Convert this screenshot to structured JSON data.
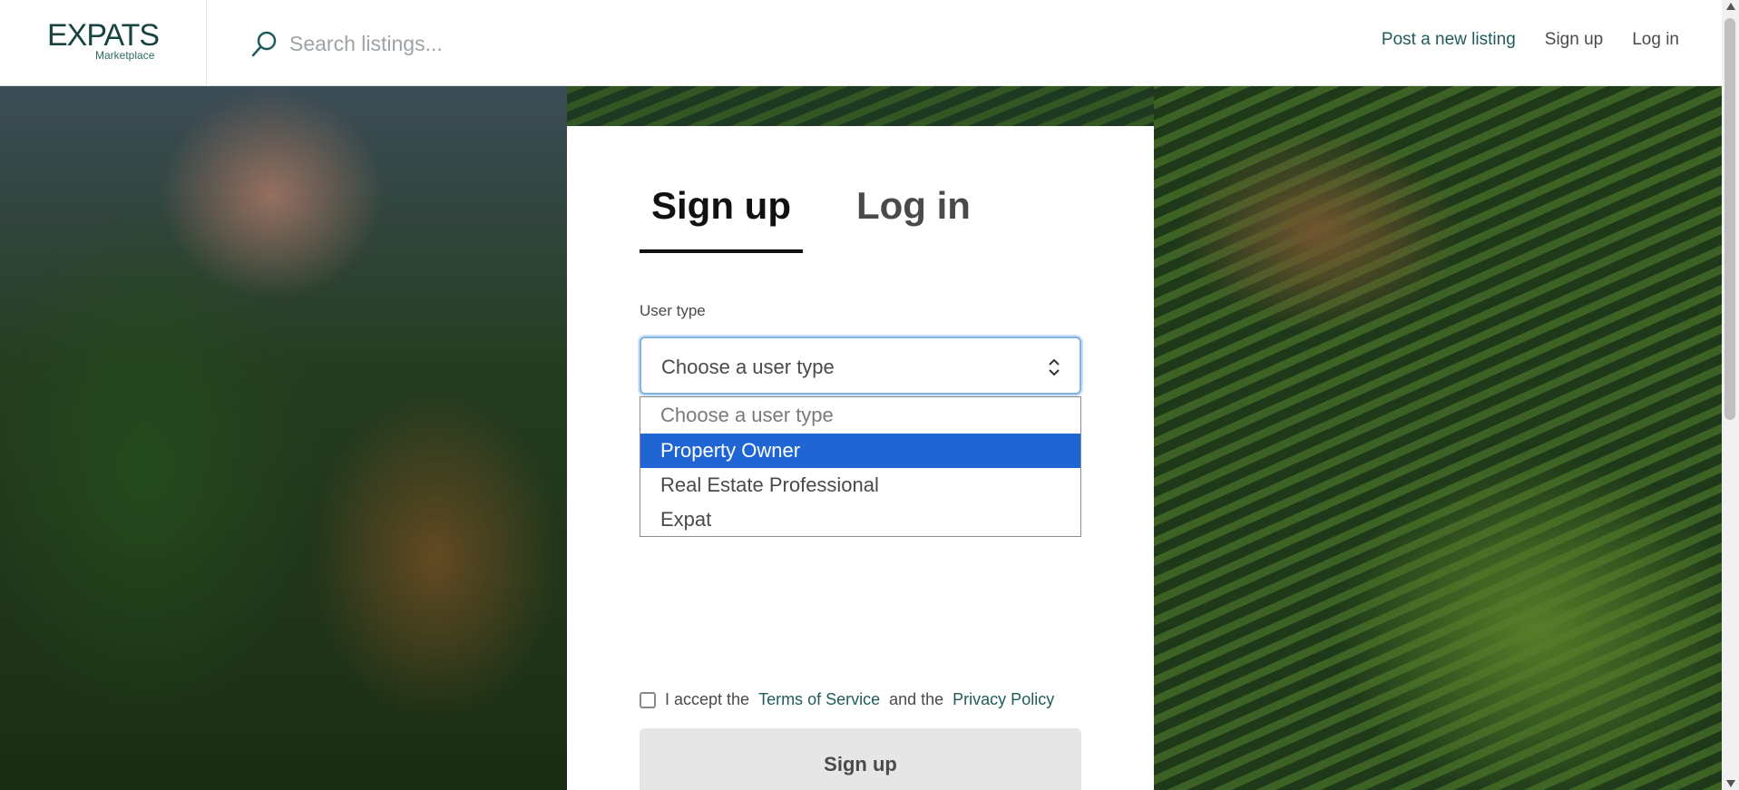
{
  "header": {
    "logo": {
      "main": "EXPATS",
      "sub": "Marketplace"
    },
    "search": {
      "placeholder": "Search listings..."
    },
    "nav": {
      "post_listing": "Post a new listing",
      "sign_up": "Sign up",
      "log_in": "Log in"
    }
  },
  "card": {
    "tabs": [
      {
        "label": "Sign up",
        "active": true
      },
      {
        "label": "Log in",
        "active": false
      }
    ],
    "user_type": {
      "label": "User type",
      "value": "Choose a user type",
      "options": [
        "Choose a user type",
        "Property Owner",
        "Real Estate Professional",
        "Expat"
      ],
      "highlighted_option": "Property Owner"
    },
    "terms": {
      "prefix": "I accept the",
      "terms_link": "Terms of Service",
      "middle": "and the",
      "privacy_link": "Privacy Policy"
    },
    "submit_label": "Sign up"
  },
  "colors": {
    "accent": "#1f5b5b",
    "option_highlight": "#1f66d4",
    "focus_ring": "#7fb2e6"
  },
  "icons": [
    "search-icon",
    "select-arrows-icon"
  ]
}
